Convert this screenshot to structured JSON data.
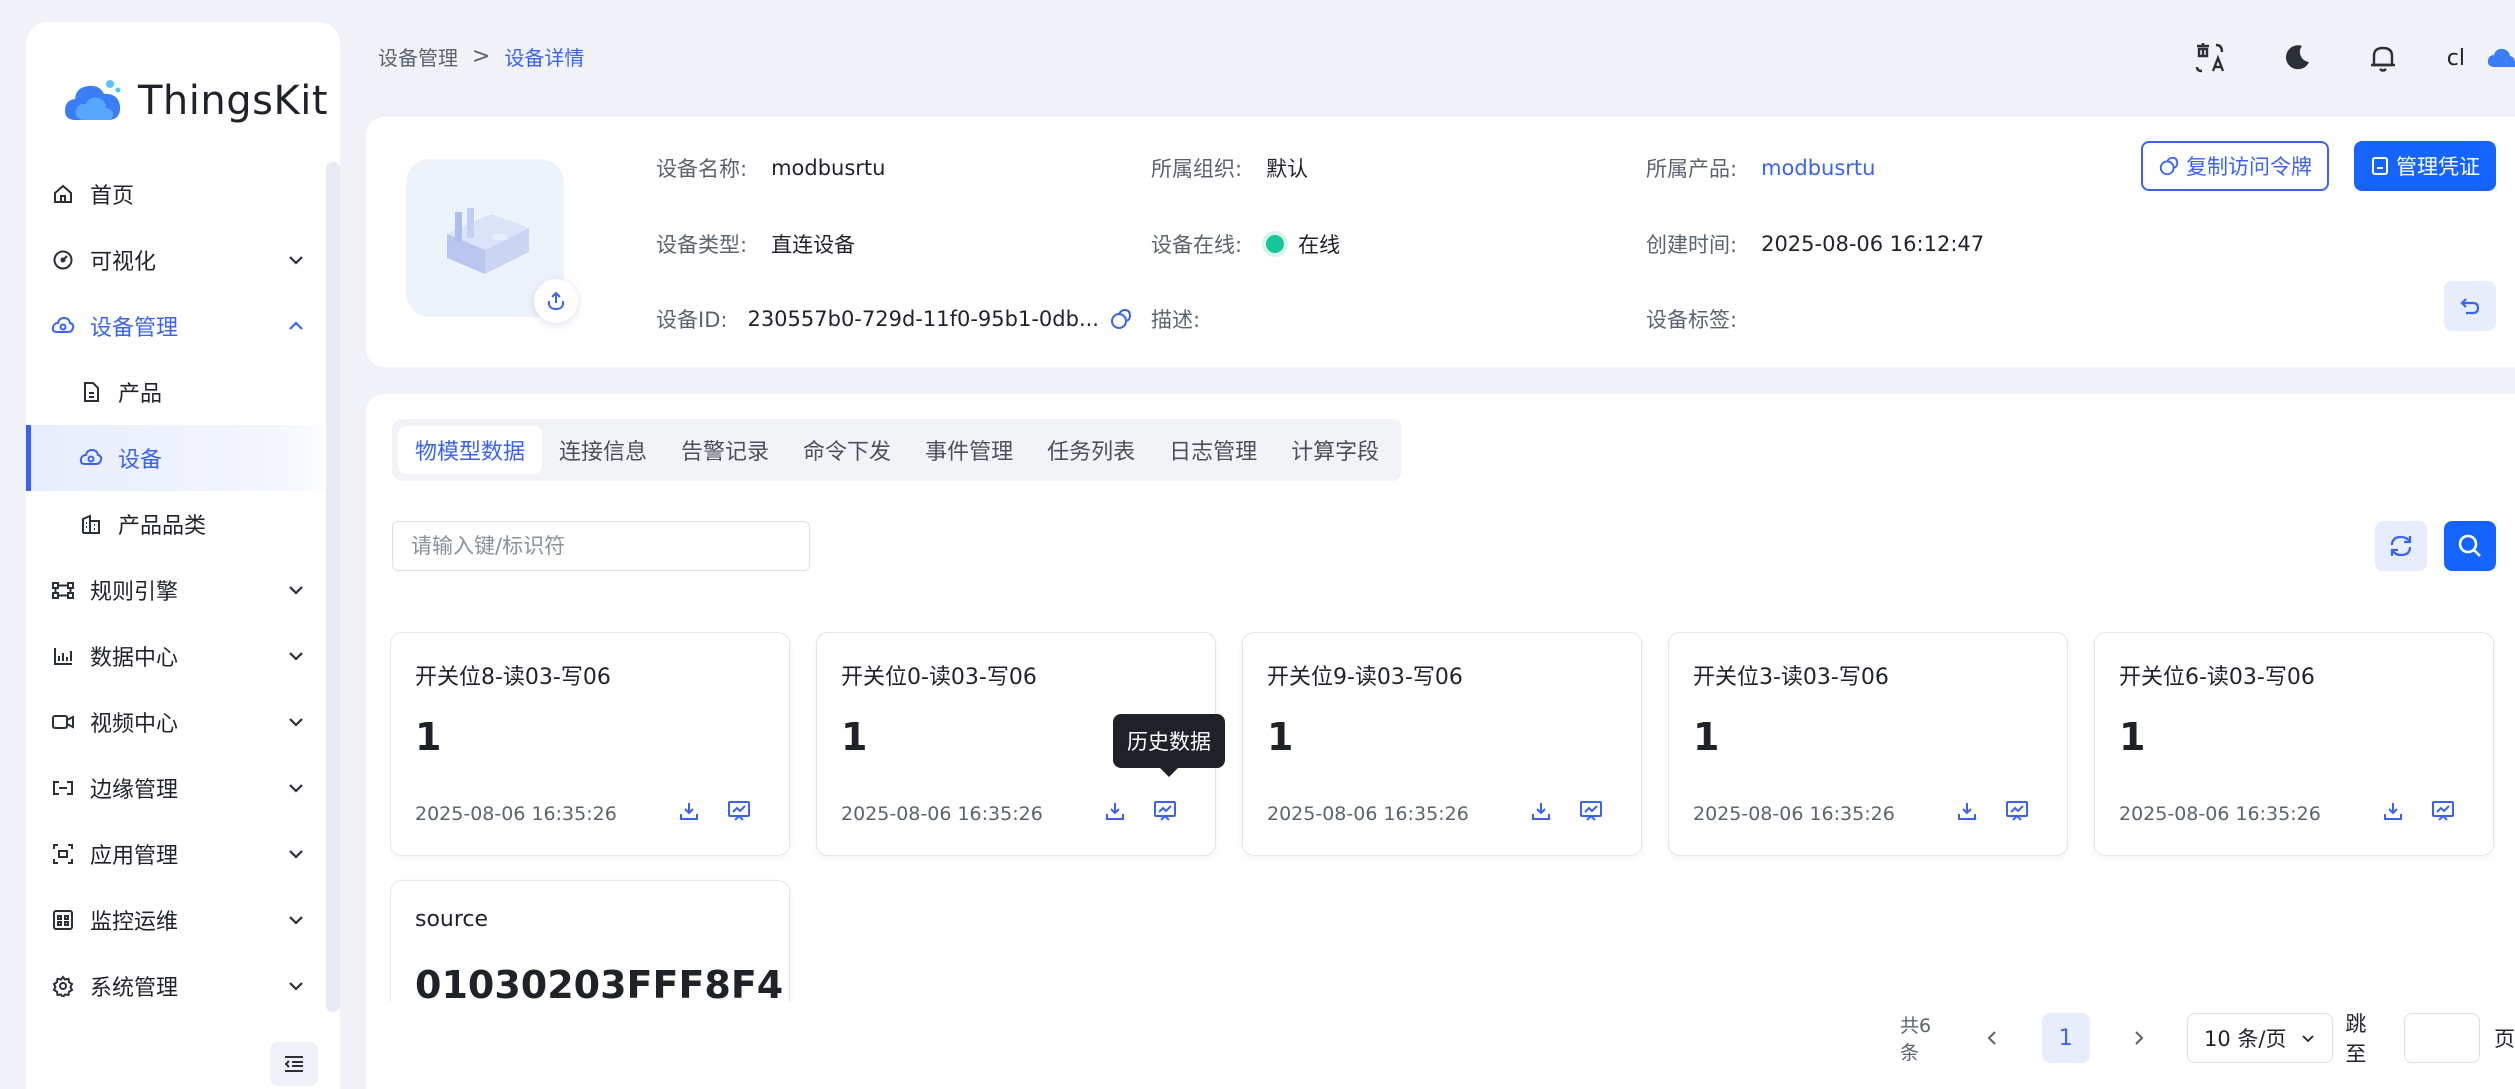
{
  "brand": {
    "name": "ThingsKit"
  },
  "sidebar": {
    "items": [
      {
        "label": "首页",
        "icon": "home-icon",
        "expandable": false
      },
      {
        "label": "可视化",
        "icon": "dashboard-icon",
        "expandable": true
      },
      {
        "label": "设备管理",
        "icon": "device-cloud-icon",
        "expandable": true,
        "open": true
      },
      {
        "label": "产品",
        "icon": "file-icon",
        "sub": true
      },
      {
        "label": "设备",
        "icon": "device-cloud-icon",
        "sub": true,
        "active": true
      },
      {
        "label": "产品品类",
        "icon": "building-icon",
        "sub": true
      },
      {
        "label": "规则引擎",
        "icon": "rule-engine-icon",
        "expandable": true
      },
      {
        "label": "数据中心",
        "icon": "bar-chart-icon",
        "expandable": true
      },
      {
        "label": "视频中心",
        "icon": "video-icon",
        "expandable": true
      },
      {
        "label": "边缘管理",
        "icon": "edge-icon",
        "expandable": true
      },
      {
        "label": "应用管理",
        "icon": "app-icon",
        "expandable": true
      },
      {
        "label": "监控运维",
        "icon": "monitor-icon",
        "expandable": true
      },
      {
        "label": "系统管理",
        "icon": "gear-icon",
        "expandable": true
      }
    ]
  },
  "breadcrumb": {
    "parent": "设备管理",
    "separator": ">",
    "current": "设备详情"
  },
  "topbar": {
    "user": "cl"
  },
  "device": {
    "name_label": "设备名称:",
    "name": "modbusrtu",
    "org_label": "所属组织:",
    "org": "默认",
    "product_label": "所属产品:",
    "product": "modbusrtu",
    "type_label": "设备类型:",
    "type": "直连设备",
    "online_label": "设备在线:",
    "online": "在线",
    "created_label": "创建时间:",
    "created": "2025-08-06 16:12:47",
    "id_label": "设备ID:",
    "id": "230557b0-729d-11f0-95b1-0db...",
    "desc_label": "描述:",
    "desc": "",
    "tags_label": "设备标签:",
    "tags": "",
    "copy_token_label": "复制访问令牌",
    "manage_cred_label": "管理凭证"
  },
  "tabs": [
    "物模型数据",
    "连接信息",
    "告警记录",
    "命令下发",
    "事件管理",
    "任务列表",
    "日志管理",
    "计算字段"
  ],
  "active_tab": 0,
  "search": {
    "placeholder": "请输入键/标识符",
    "value": ""
  },
  "cards": [
    {
      "title": "开关位8-读03-写06",
      "value": "1",
      "time": "2025-08-06 16:35:26"
    },
    {
      "title": "开关位0-读03-写06",
      "value": "1",
      "time": "2025-08-06 16:35:26"
    },
    {
      "title": "开关位9-读03-写06",
      "value": "1",
      "time": "2025-08-06 16:35:26"
    },
    {
      "title": "开关位3-读03-写06",
      "value": "1",
      "time": "2025-08-06 16:35:26"
    },
    {
      "title": "开关位6-读03-写06",
      "value": "1",
      "time": "2025-08-06 16:35:26"
    },
    {
      "title": "source",
      "value": "01030203FFF8F4",
      "time": ""
    }
  ],
  "tooltip": "历史数据",
  "pagination": {
    "total": "共6条",
    "current_page": "1",
    "page_size": "10 条/页",
    "jump_label": "跳至",
    "page_label": "页"
  },
  "colors": {
    "accent": "#3a63f3",
    "primary_button": "#1664ff",
    "online": "#19c59a"
  }
}
